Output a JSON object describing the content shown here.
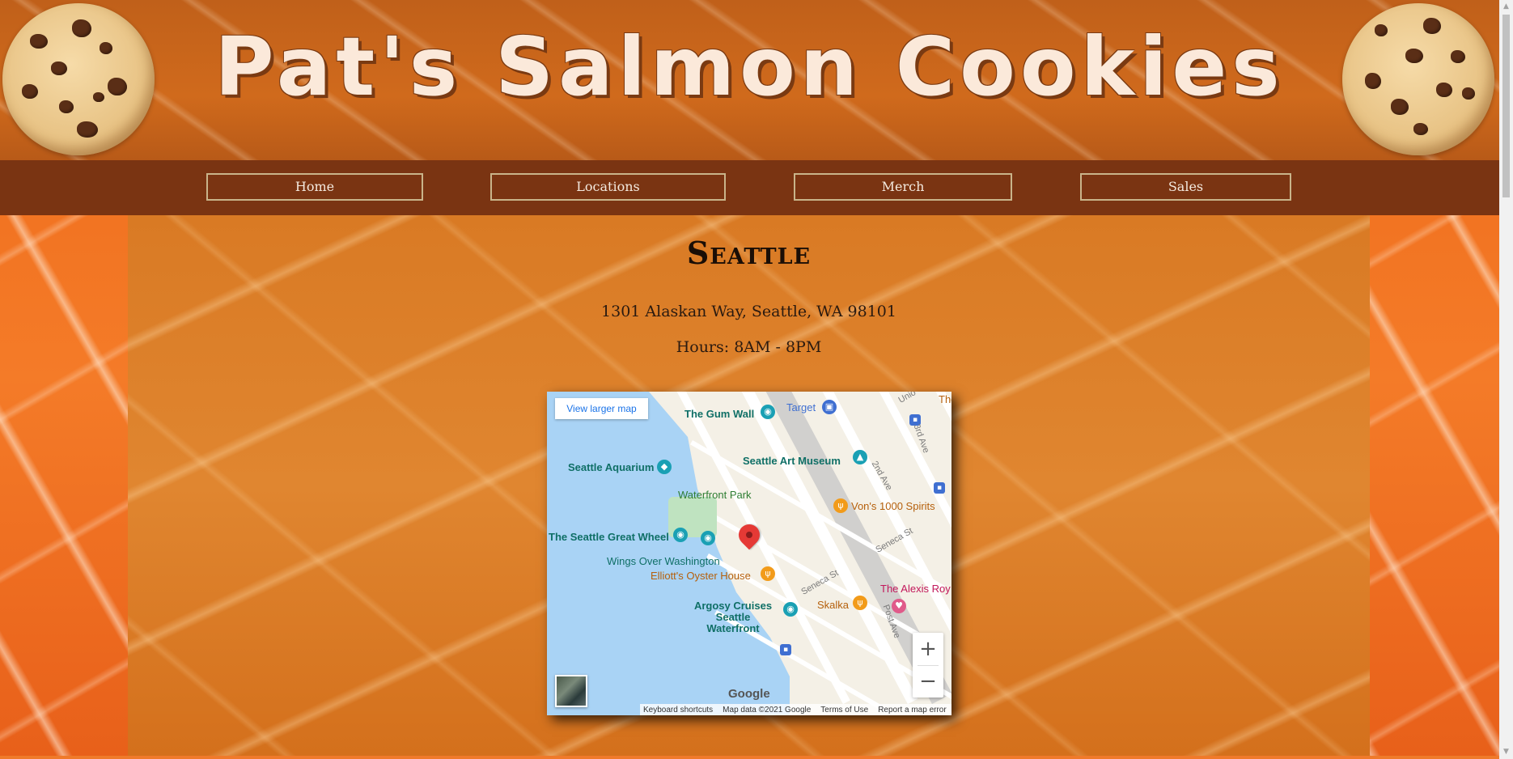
{
  "header": {
    "title": "Pat's Salmon Cookies"
  },
  "nav": {
    "items": [
      {
        "label": "Home"
      },
      {
        "label": "Locations"
      },
      {
        "label": "Merch"
      },
      {
        "label": "Sales"
      }
    ]
  },
  "location": {
    "name": "Seattle",
    "address": "1301 Alaskan Way, Seattle, WA 98101",
    "hours": "Hours: 8AM - 8PM"
  },
  "map": {
    "view_larger_label": "View larger map",
    "zoom_in": "+",
    "zoom_out": "−",
    "google_logo": "Google",
    "attribution": {
      "shortcuts": "Keyboard shortcuts",
      "data": "Map data ©2021 Google",
      "terms": "Terms of Use",
      "report": "Report a map error"
    },
    "labels": {
      "gum_wall": "The Gum Wall",
      "target": "Target",
      "art_museum": "Seattle Art Museum",
      "aquarium": "Seattle Aquarium",
      "waterfront_park": "Waterfront Park",
      "vons": "Von's 1000 Spirits",
      "great_wheel": "The Seattle Great Wheel",
      "wings": "Wings Over Washington",
      "elliotts": "Elliott's Oyster House",
      "alexis": "The Alexis Roy",
      "argosy": "Argosy Cruises Seattle Waterfront",
      "skalka": "Skalka",
      "second_ave": "2nd Ave",
      "third_ave": "3rd Ave",
      "seneca_st": "Seneca St",
      "post_ave": "Post Ave",
      "union": "Unio",
      "the": "The"
    }
  },
  "colors": {
    "nav_background": "#7a3412",
    "nav_border": "#c9b48a",
    "title_text": "#fbe9da",
    "pin": "#e53935"
  }
}
